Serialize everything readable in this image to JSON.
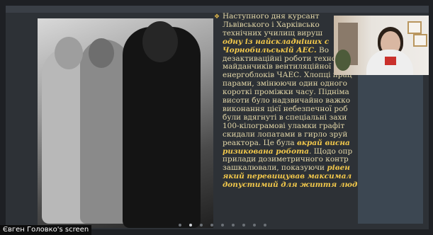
{
  "slide": {
    "lines": [
      "Наступного дня курсант",
      "Львівського і Харківсько",
      "технічних училищ вируш"
    ],
    "hl1": [
      "одну із найскладніших с",
      "Чорнобильській АЕС."
    ],
    "hl1_after": " Во",
    "lines2": [
      "дезактиваційні роботи техноло",
      "майданчиків вентиляційної тру",
      "енергоблоків ЧАЕС. Хлопці прац",
      "парами, змінюючи один одного",
      "короткі проміжки часу. Підніма",
      "висоти було надзвичайно важко",
      "виконання цієї небезпечної роб",
      "були вдягнуті в спеціальні захи",
      "100-кілограмові уламки графіт",
      "скидали лопатами в гирло зруй"
    ],
    "reactor_prefix": "реактора. Це була ",
    "hl2_a": "вкрай висна",
    "hl2_b": "ризикована робота",
    "after_hl2": ". Щодо опр",
    "lines3": [
      "прилади дозиметричного контр",
      "зашкалювали, показуючи "
    ],
    "hl3_a": "рівен",
    "hl3_lines": [
      "який перевищував максимал",
      "допустимий для життя люд"
    ]
  },
  "screen_share_label": "Євген Головко's screen",
  "pager": {
    "count": 9,
    "active": 1
  }
}
